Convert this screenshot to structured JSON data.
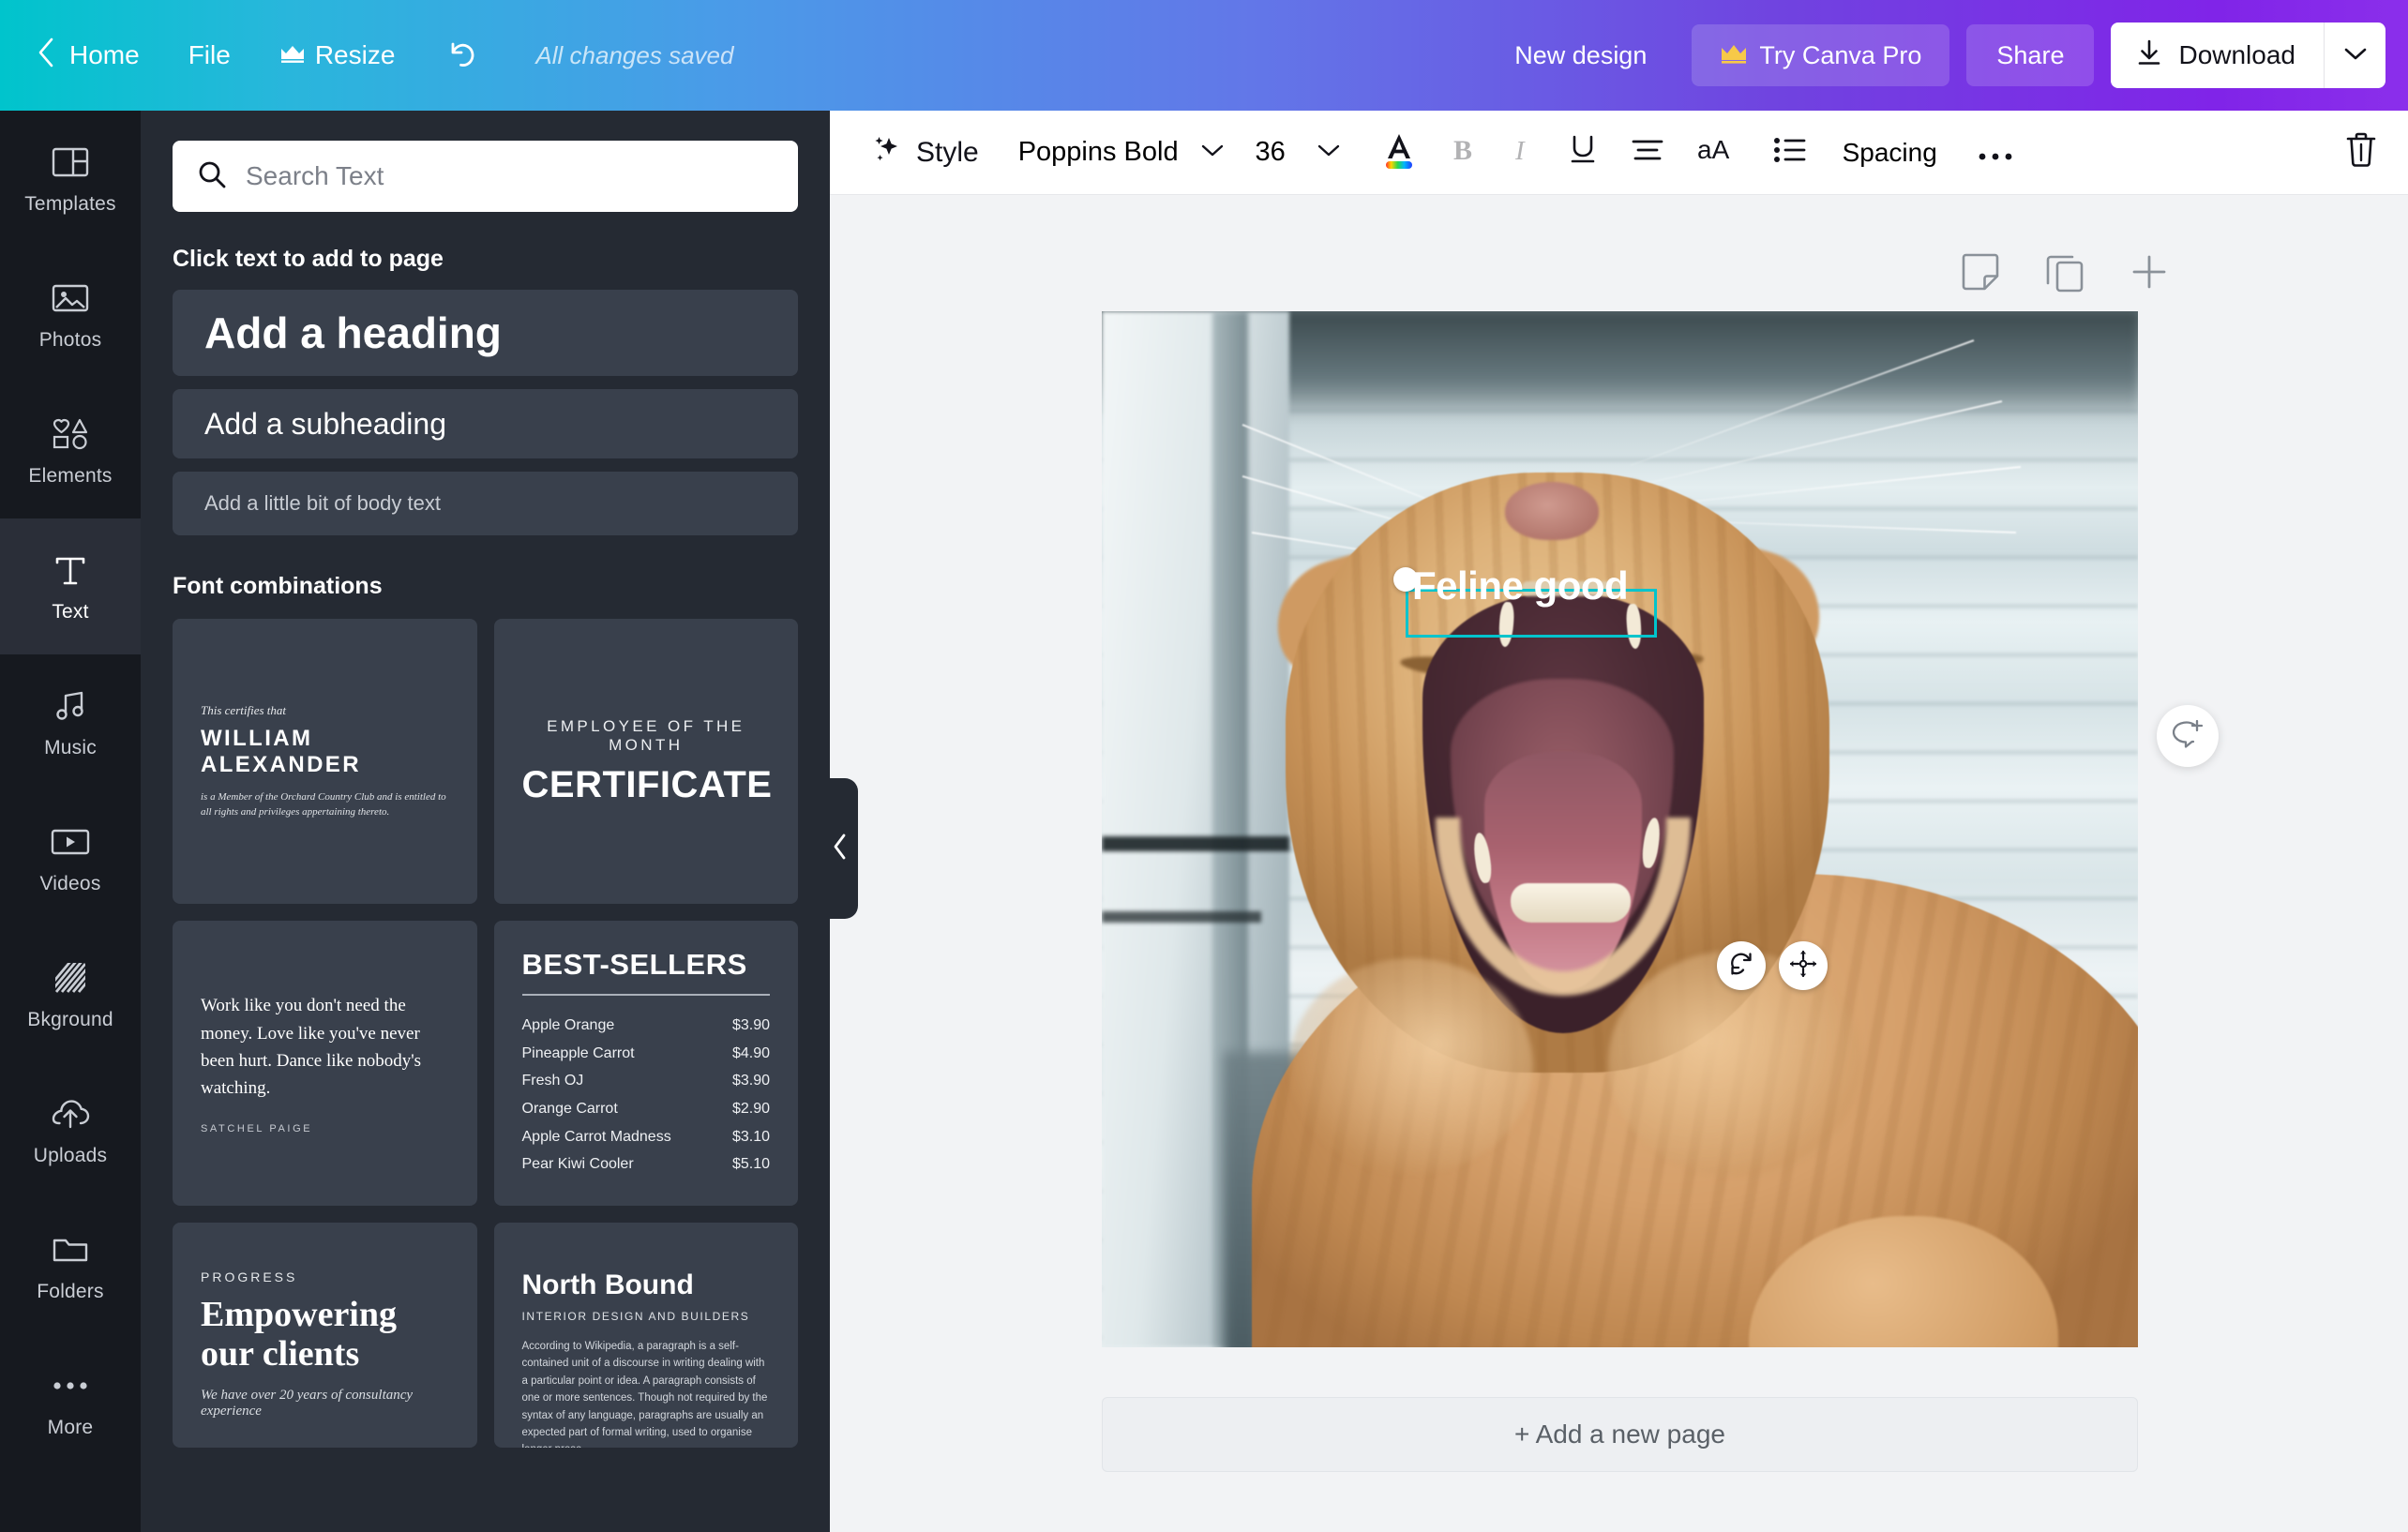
{
  "topbar": {
    "home": "Home",
    "file": "File",
    "resize": "Resize",
    "saved_status": "All changes saved",
    "new_design": "New design",
    "try_pro": "Try Canva Pro",
    "share": "Share",
    "download": "Download",
    "crown_icon": "crown-icon",
    "undo_icon": "undo-icon",
    "back_chevron_icon": "chevron-left-icon",
    "download_icon": "download-icon",
    "caret_icon": "chevron-down-icon",
    "gradient_start": "#00C4CC",
    "gradient_end": "#8B2FEB"
  },
  "rail": {
    "items": [
      {
        "label": "Templates",
        "icon": "templates-icon",
        "active": false
      },
      {
        "label": "Photos",
        "icon": "photos-icon",
        "active": false
      },
      {
        "label": "Elements",
        "icon": "elements-icon",
        "active": false
      },
      {
        "label": "Text",
        "icon": "text-icon",
        "active": true
      },
      {
        "label": "Music",
        "icon": "music-icon",
        "active": false
      },
      {
        "label": "Videos",
        "icon": "videos-icon",
        "active": false
      },
      {
        "label": "Bkground",
        "icon": "background-icon",
        "active": false
      },
      {
        "label": "Uploads",
        "icon": "uploads-icon",
        "active": false
      },
      {
        "label": "Folders",
        "icon": "folders-icon",
        "active": false
      },
      {
        "label": "More",
        "icon": "more-dots-icon",
        "active": false
      }
    ]
  },
  "panel": {
    "search_placeholder": "Search Text",
    "search_value": "",
    "search_icon": "search-icon",
    "click_text_title": "Click text to add to page",
    "add_heading": "Add a heading",
    "add_subheading": "Add a subheading",
    "add_body": "Add a little bit of body text",
    "font_combinations_title": "Font combinations",
    "collapse_icon": "chevron-left-icon",
    "combos": [
      {
        "name": "certificate-member",
        "small": "This certifies that",
        "name_line": "WILLIAM ALEXANDER",
        "body": "is a Member of the Orchard Country Club and is entitled to all rights and privileges appertaining thereto."
      },
      {
        "name": "employee-of-the-month",
        "kicker": "EMPLOYEE OF THE MONTH",
        "title": "CERTIFICATE"
      },
      {
        "name": "satchel-paige-quote",
        "quote": "Work like you don't need the money. Love like you've never been hurt. Dance like nobody's watching.",
        "author": "SATCHEL PAIGE"
      },
      {
        "name": "best-sellers-menu",
        "title": "BEST-SELLERS",
        "rows": [
          {
            "item": "Apple Orange",
            "price": "$3.90"
          },
          {
            "item": "Pineapple Carrot",
            "price": "$4.90"
          },
          {
            "item": "Fresh OJ",
            "price": "$3.90"
          },
          {
            "item": "Orange Carrot",
            "price": "$2.90"
          },
          {
            "item": "Apple Carrot Madness",
            "price": "$3.10"
          },
          {
            "item": "Pear Kiwi Cooler",
            "price": "$5.10"
          }
        ]
      },
      {
        "name": "progress-empowering",
        "kicker": "PROGRESS",
        "title": "Empowering our clients",
        "body": "We have over 20 years of consultancy experience"
      },
      {
        "name": "north-bound",
        "title": "North Bound",
        "sub": "INTERIOR DESIGN AND BUILDERS",
        "body": "According to Wikipedia, a paragraph is a self-contained unit of a discourse in writing dealing with a particular point or idea. A paragraph consists of one or more sentences. Though not required by the syntax of any language, paragraphs are usually an expected part of formal writing, used to organise longer prose."
      }
    ]
  },
  "toolbar": {
    "style_label": "Style",
    "style_icon": "sparkle-icon",
    "font_family": "Poppins Bold",
    "font_size": "36",
    "font_color_icon": "font-color-icon",
    "bold_icon": "bold-icon",
    "italic_icon": "italic-icon",
    "underline_icon": "underline-icon",
    "align_icon": "align-center-icon",
    "case_icon": "text-case-icon",
    "list_icon": "bullet-list-icon",
    "spacing_label": "Spacing",
    "more_icon": "more-dots-icon",
    "delete_icon": "trash-icon",
    "bold_active": false,
    "italic_active": false,
    "underline_active": false
  },
  "canvas": {
    "notes_icon": "notes-icon",
    "duplicate_icon": "duplicate-page-icon",
    "add_icon": "plus-icon",
    "comment_icon": "add-comment-icon",
    "selected_text": "Feline good",
    "selection_color": "#00C4CC",
    "rotate_icon": "rotate-icon",
    "move_icon": "move-icon",
    "add_new_page": "+ Add a new page",
    "image_description": "yawning orange tabby cat"
  }
}
